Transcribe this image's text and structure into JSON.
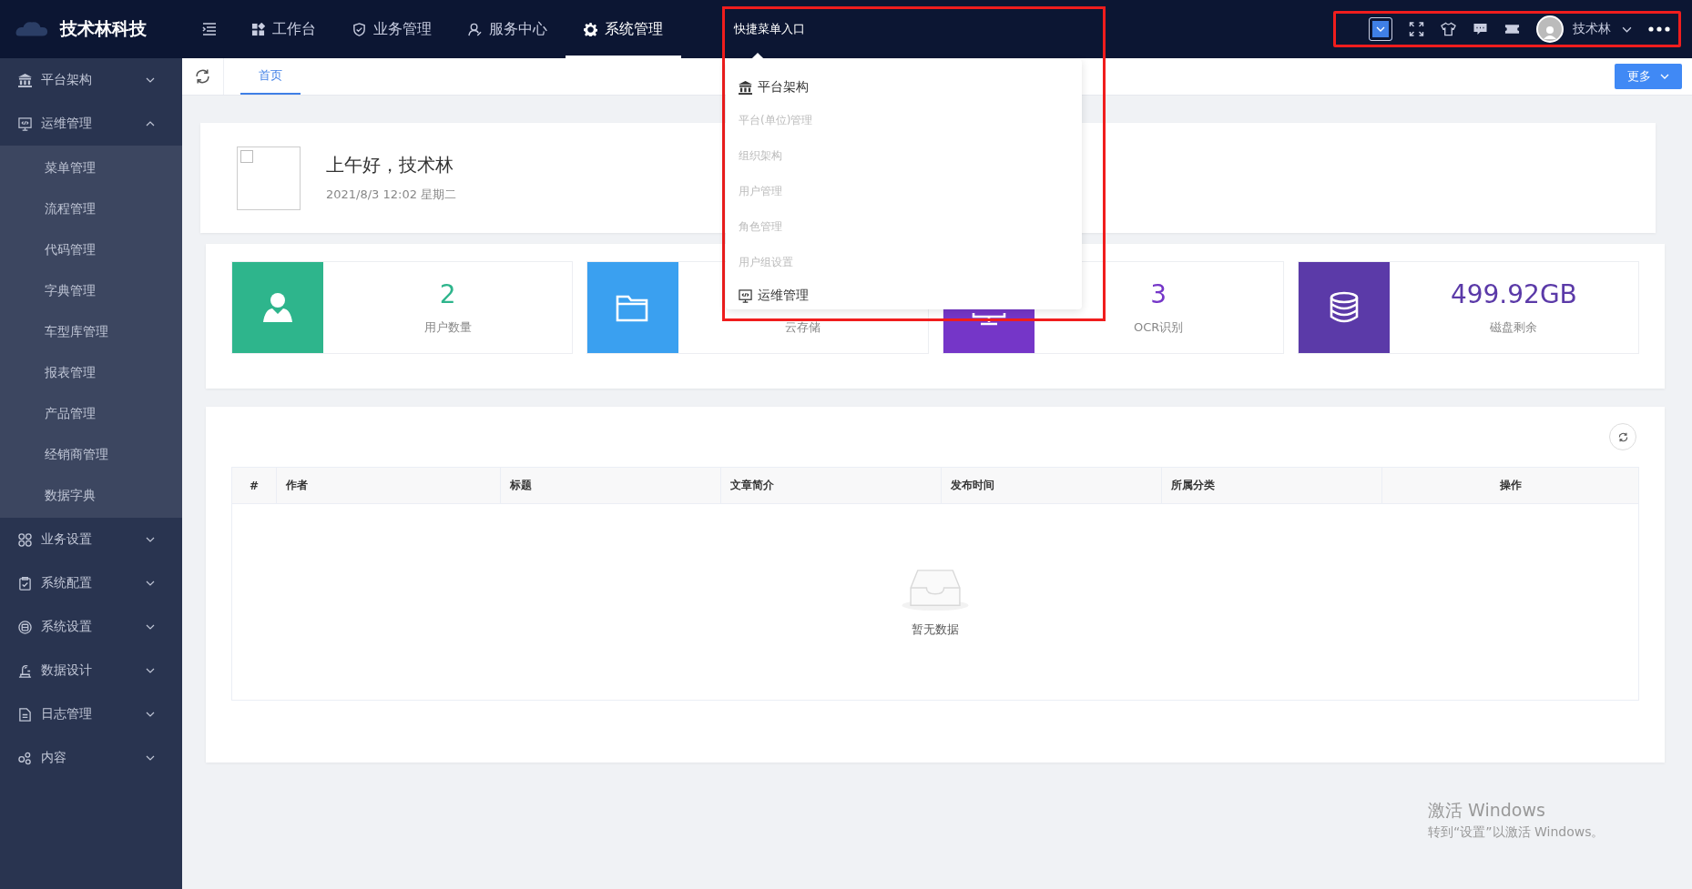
{
  "header": {
    "brand": "技术林科技",
    "nav": [
      {
        "label": "工作台",
        "selected": false
      },
      {
        "label": "业务管理",
        "selected": false
      },
      {
        "label": "服务中心",
        "selected": false
      },
      {
        "label": "系统管理",
        "selected": true
      }
    ],
    "quick_menu": "快捷菜单入口",
    "user": "技术林"
  },
  "sidebar": [
    {
      "label": "平台架构",
      "expanded": false
    },
    {
      "label": "运维管理",
      "expanded": true,
      "children": [
        "菜单管理",
        "流程管理",
        "代码管理",
        "字典管理",
        "车型库管理",
        "报表管理",
        "产品管理",
        "经销商管理",
        "数据字典"
      ]
    },
    {
      "label": "业务设置",
      "expanded": false
    },
    {
      "label": "系统配置",
      "expanded": false
    },
    {
      "label": "系统设置",
      "expanded": false
    },
    {
      "label": "数据设计",
      "expanded": false
    },
    {
      "label": "日志管理",
      "expanded": false
    },
    {
      "label": "内容",
      "expanded": false
    }
  ],
  "tabs": [
    {
      "label": "首页",
      "selected": true
    }
  ],
  "more_button": "更多",
  "greeting": {
    "title": "上午好，技术林",
    "date": "2021/8/3 12:02 星期二"
  },
  "stats": [
    {
      "value": "2",
      "label": "用户数量",
      "color": "#2eb58c"
    },
    {
      "label": "云存储",
      "color": "#3aa0f0"
    },
    {
      "value": "3",
      "label": "OCR识别",
      "color": "#7536c8"
    },
    {
      "value": "499.92GB",
      "label": "磁盘剩余",
      "color": "#5b3aa8"
    }
  ],
  "table": {
    "columns": [
      "#",
      "作者",
      "标题",
      "文章简介",
      "发布时间",
      "所属分类",
      "操作"
    ],
    "empty_text": "暂无数据"
  },
  "quick_dropdown": [
    {
      "label": "平台架构",
      "kind": "group"
    },
    {
      "label": "平台(单位)管理",
      "kind": "item"
    },
    {
      "label": "组织架构",
      "kind": "item"
    },
    {
      "label": "用户管理",
      "kind": "item"
    },
    {
      "label": "角色管理",
      "kind": "item"
    },
    {
      "label": "用户组设置",
      "kind": "item"
    },
    {
      "label": "运维管理",
      "kind": "group"
    }
  ],
  "os_notice": {
    "title": "激活 Windows",
    "subtitle": "转到“设置”以激活 Windows。"
  }
}
